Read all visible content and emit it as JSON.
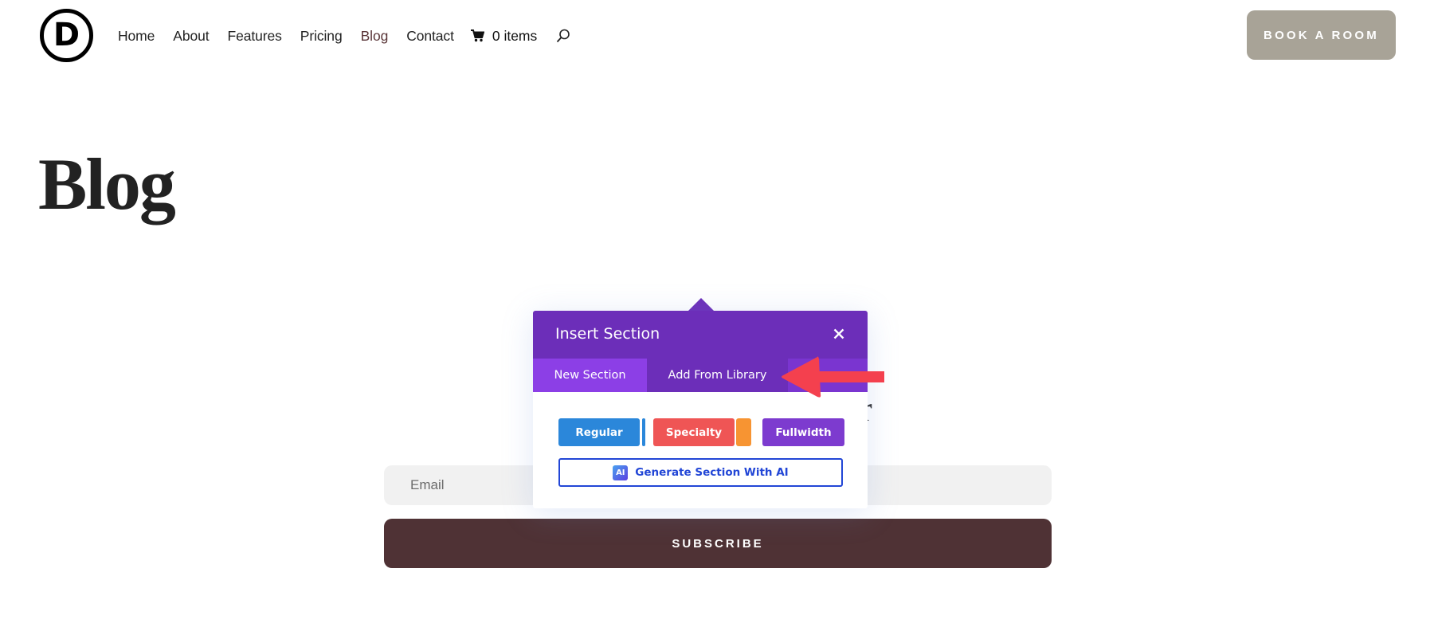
{
  "header": {
    "logo_letter": "D",
    "nav": [
      {
        "label": "Home",
        "active": false
      },
      {
        "label": "About",
        "active": false
      },
      {
        "label": "Features",
        "active": false
      },
      {
        "label": "Pricing",
        "active": false
      },
      {
        "label": "Blog",
        "active": true
      },
      {
        "label": "Contact",
        "active": false
      }
    ],
    "cart": {
      "icon": "cart-icon",
      "label": "0 items"
    },
    "search_icon": "search-icon",
    "book_button": "BOOK A ROOM"
  },
  "page": {
    "title": "Blog"
  },
  "newsletter": {
    "heading_visible_fragment": "r",
    "email_placeholder": "Email",
    "subscribe_label": "SUBSCRIBE"
  },
  "dialog": {
    "title": "Insert Section",
    "close_icon": "close-icon",
    "tabs": [
      {
        "label": "New Section",
        "active": true
      },
      {
        "label": "Add From Library",
        "active": false
      }
    ],
    "section_types": [
      {
        "label": "Regular",
        "color": "#2b87da"
      },
      {
        "label": "Specialty",
        "color": "#ef5555"
      },
      {
        "label": "Fullwidth",
        "color": "#7d3bcf"
      }
    ],
    "ai_badge": "AI",
    "ai_button": "Generate Section With AI"
  },
  "colors": {
    "dialog_header": "#6c2eb9",
    "active_tab": "#8c3fe6",
    "book_button": "#a8a397",
    "subscribe_button": "#4f3235",
    "annotation_arrow": "#f4404e",
    "ai_accent": "#2246d6"
  }
}
